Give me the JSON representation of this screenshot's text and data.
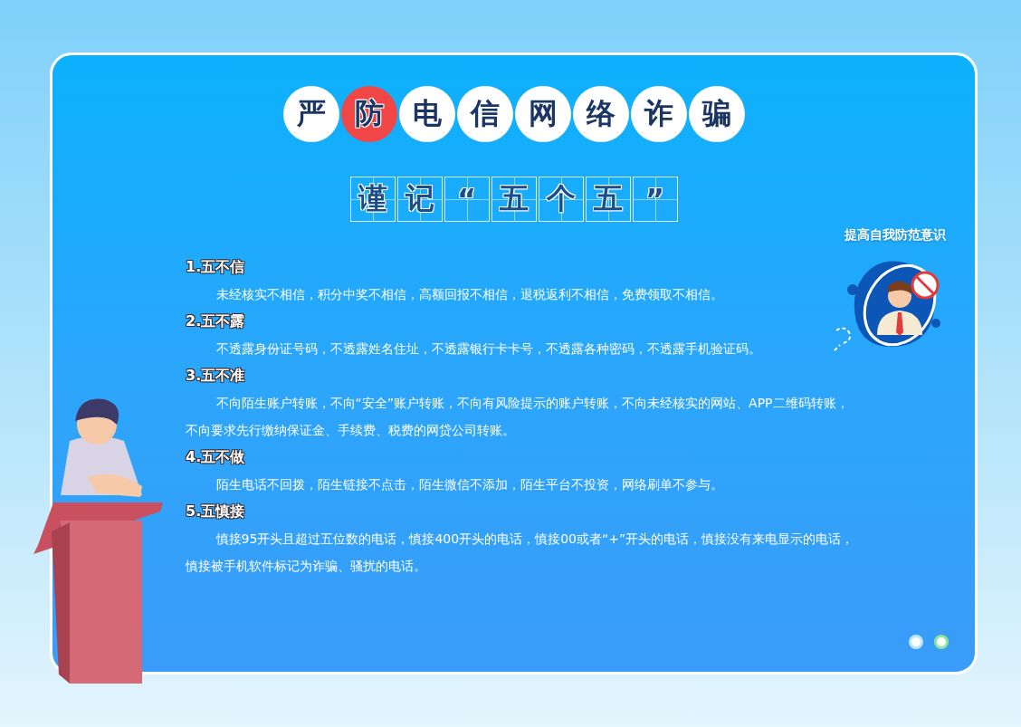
{
  "title": [
    {
      "char": "严",
      "highlight": false
    },
    {
      "char": "防",
      "highlight": true
    },
    {
      "char": "电",
      "highlight": false
    },
    {
      "char": "信",
      "highlight": false
    },
    {
      "char": "网",
      "highlight": false
    },
    {
      "char": "络",
      "highlight": false
    },
    {
      "char": "诈",
      "highlight": false
    },
    {
      "char": "骗",
      "highlight": false
    }
  ],
  "subtitle": [
    "谨",
    "记",
    "“",
    "五",
    "个",
    "五",
    "”"
  ],
  "badge": {
    "label": "提高自我防范意识"
  },
  "sections": [
    {
      "heading": "1.五不信",
      "body": "未经核实不相信，积分中奖不相信，高额回报不相信，退税返利不相信，免费领取不相信。"
    },
    {
      "heading": "2.五不露",
      "body": "不透露身份证号码，不透露姓名住址，不透露银行卡卡号，不透露各种密码，不透露手机验证码。"
    },
    {
      "heading": "3.五不准",
      "body": "不向陌生账户转账，不向“安全”账户转账，不向有风险提示的账户转账，不向未经核实的网站、APP二维码转账，不向要求先行缴纳保证金、手续费、税费的网贷公司转账。"
    },
    {
      "heading": "4.五不做",
      "body": "陌生电话不回拨，陌生链接不点击，陌生微信不添加，陌生平台不投资，网络刷单不参与。"
    },
    {
      "heading": "5.五慎接",
      "body": "慎接95开头且超过五位数的电话，慎接400开头的电话，慎接00或者“+”开头的电话，慎接没有来电显示的电话，慎接被手机软件标记为诈骗、骚扰的电话。"
    }
  ]
}
